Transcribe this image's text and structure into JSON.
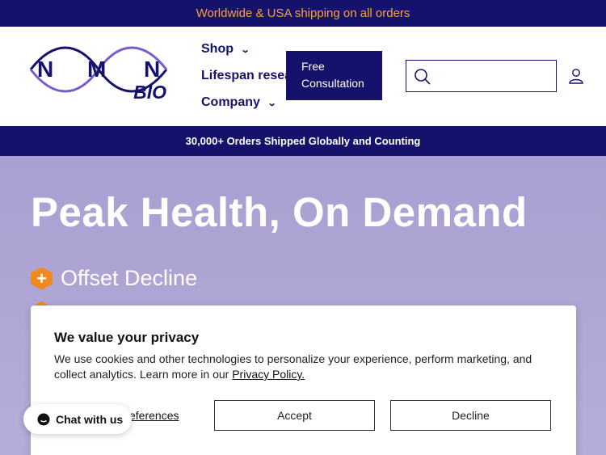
{
  "announcement": "Worldwide & USA shipping on all orders",
  "logo": {
    "letters": "NMN",
    "sub": "BIO"
  },
  "nav": {
    "shop": "Shop",
    "lifespan": "Lifespan research",
    "company": "Company"
  },
  "consult_button": "Free Consultation",
  "search": {
    "placeholder": ""
  },
  "promo": "30,000+ Orders Shipped Globally and Counting",
  "hero": {
    "title": "Peak Health, On Demand",
    "bullets": [
      "Offset Decline"
    ]
  },
  "cookie": {
    "title": "We value your privacy",
    "text": "We use cookies and other technologies to personalize your experience, perform marketing, and collect analytics. Learn more in our ",
    "policy_link": "Privacy Policy.",
    "preferences": "eferences",
    "accept": "Accept",
    "decline": "Decline"
  },
  "chat": "Chat with us",
  "colors": {
    "navy": "#15126b",
    "orange": "#f08a1e",
    "hero_bg": "#ada4d4"
  }
}
